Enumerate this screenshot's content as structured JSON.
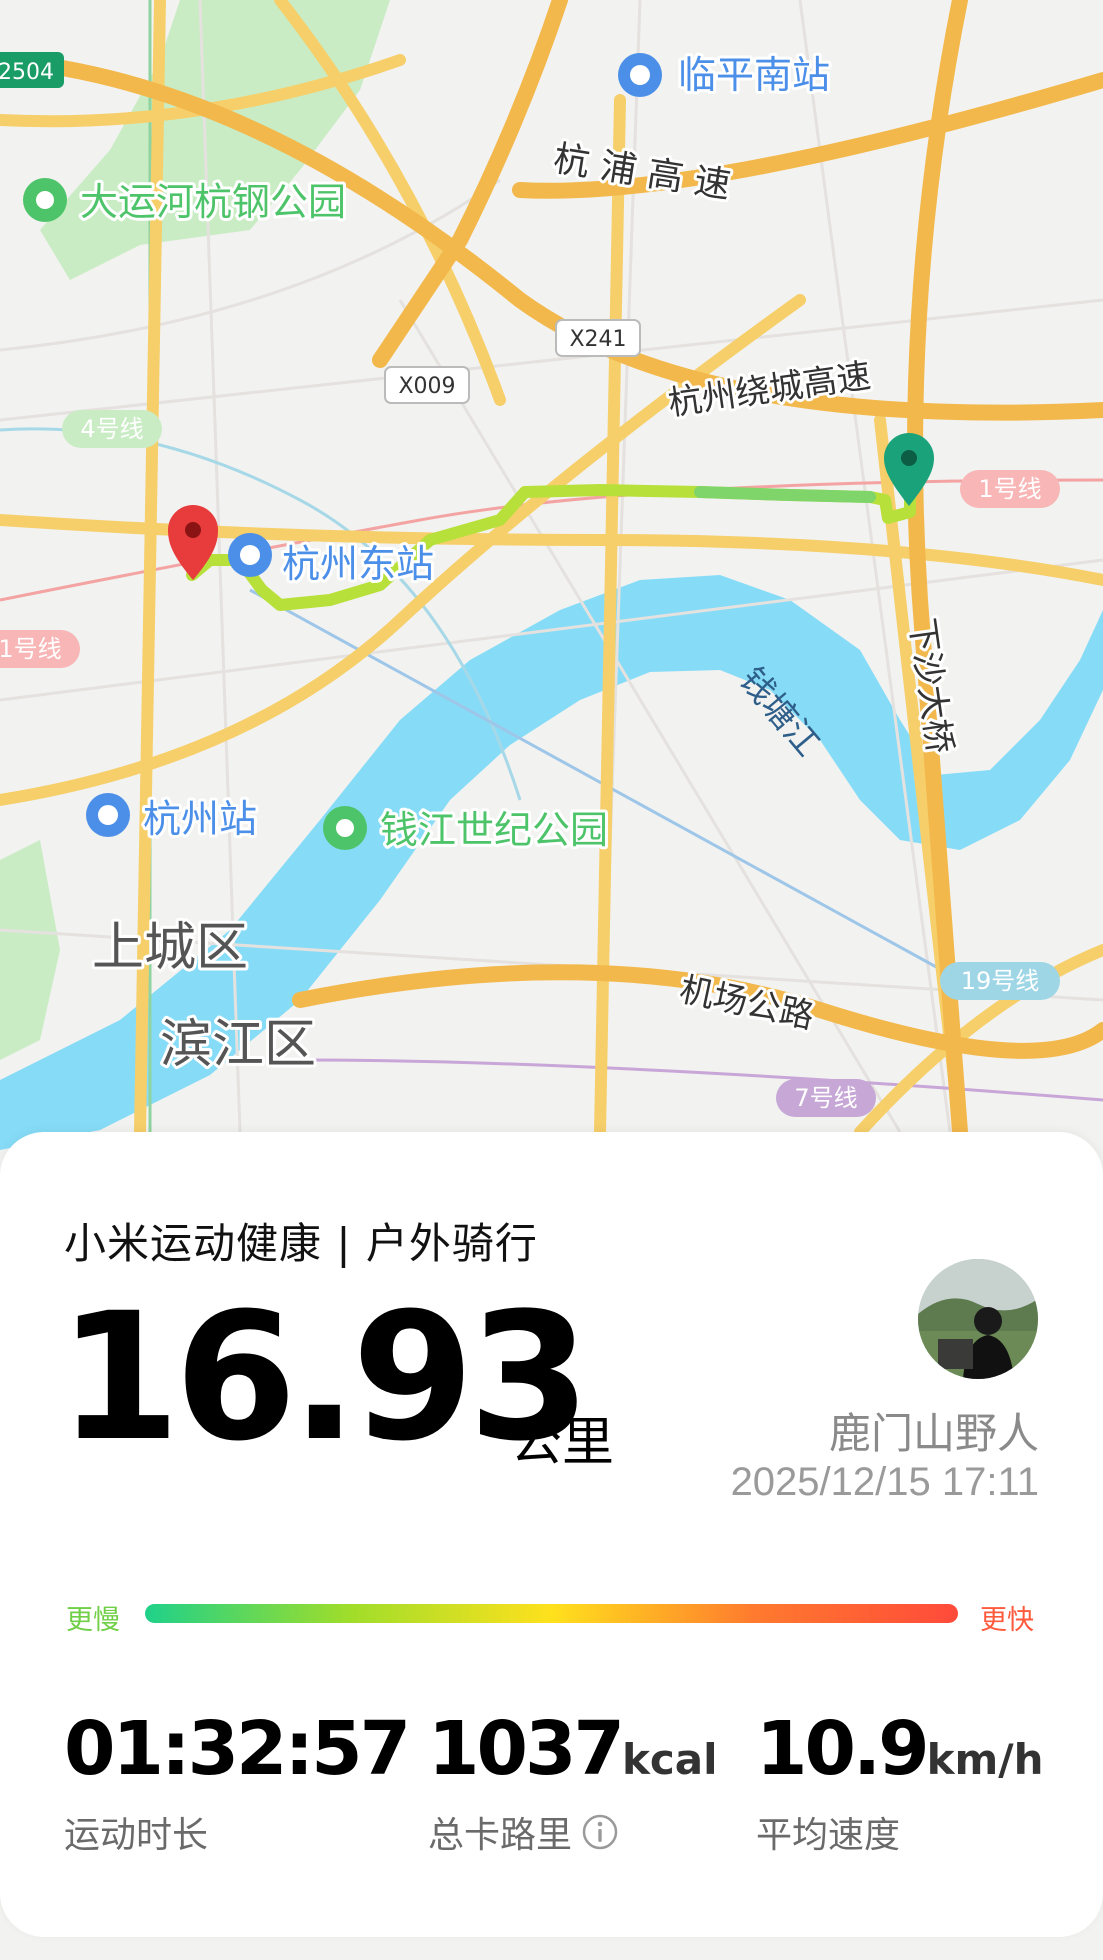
{
  "map": {
    "labels": {
      "linping_south": "临平南站",
      "hangpu_expressway": "杭 浦 高 速",
      "grand_canal_park": "大运河杭钢公园",
      "x241": "X241",
      "x009": "X009",
      "line4": "4号线",
      "raocheng_expressway": "杭州绕城高速",
      "line1_right": "1号线",
      "hangzhou_east": "杭州东站",
      "line1_left": "1号线",
      "xiasha_bridge": "下沙大桥",
      "qiantang_river": "钱塘江",
      "hangzhou_station": "杭州站",
      "qianjiang_park": "钱江世纪公园",
      "shangcheng": "上城区",
      "binjiang": "滨江区",
      "airport_road": "机场公路",
      "line19": "19号线",
      "line7": "7号线",
      "road_2504": "2504"
    },
    "colors": {
      "land": "#f2f2f0",
      "water": "#86dcf7",
      "park": "#c9ecc4",
      "major_road": "#f6cf6a",
      "expressway": "#f3b84b",
      "route_green": "#8edb3c",
      "route_yellow": "#d9e43c",
      "start_pin": "#1aa37a",
      "end_pin": "#e83b3b",
      "station_icon": "#4b8fe8",
      "park_icon": "#4ec46a"
    }
  },
  "card": {
    "app_title": "小米运动健康 | 户外骑行",
    "distance_value": "16.93",
    "distance_unit": "公里",
    "username": "鹿门山野人",
    "datetime": "2025/12/15 17:11",
    "pace_scale": {
      "slow": "更慢",
      "fast": "更快"
    },
    "stats": [
      {
        "value": "01:32:57",
        "unit": "",
        "label": "运动时长"
      },
      {
        "value": "1037",
        "unit": "kcal",
        "label": "总卡路里"
      },
      {
        "value": "10.9",
        "unit": "km/h",
        "label": "平均速度"
      }
    ]
  }
}
